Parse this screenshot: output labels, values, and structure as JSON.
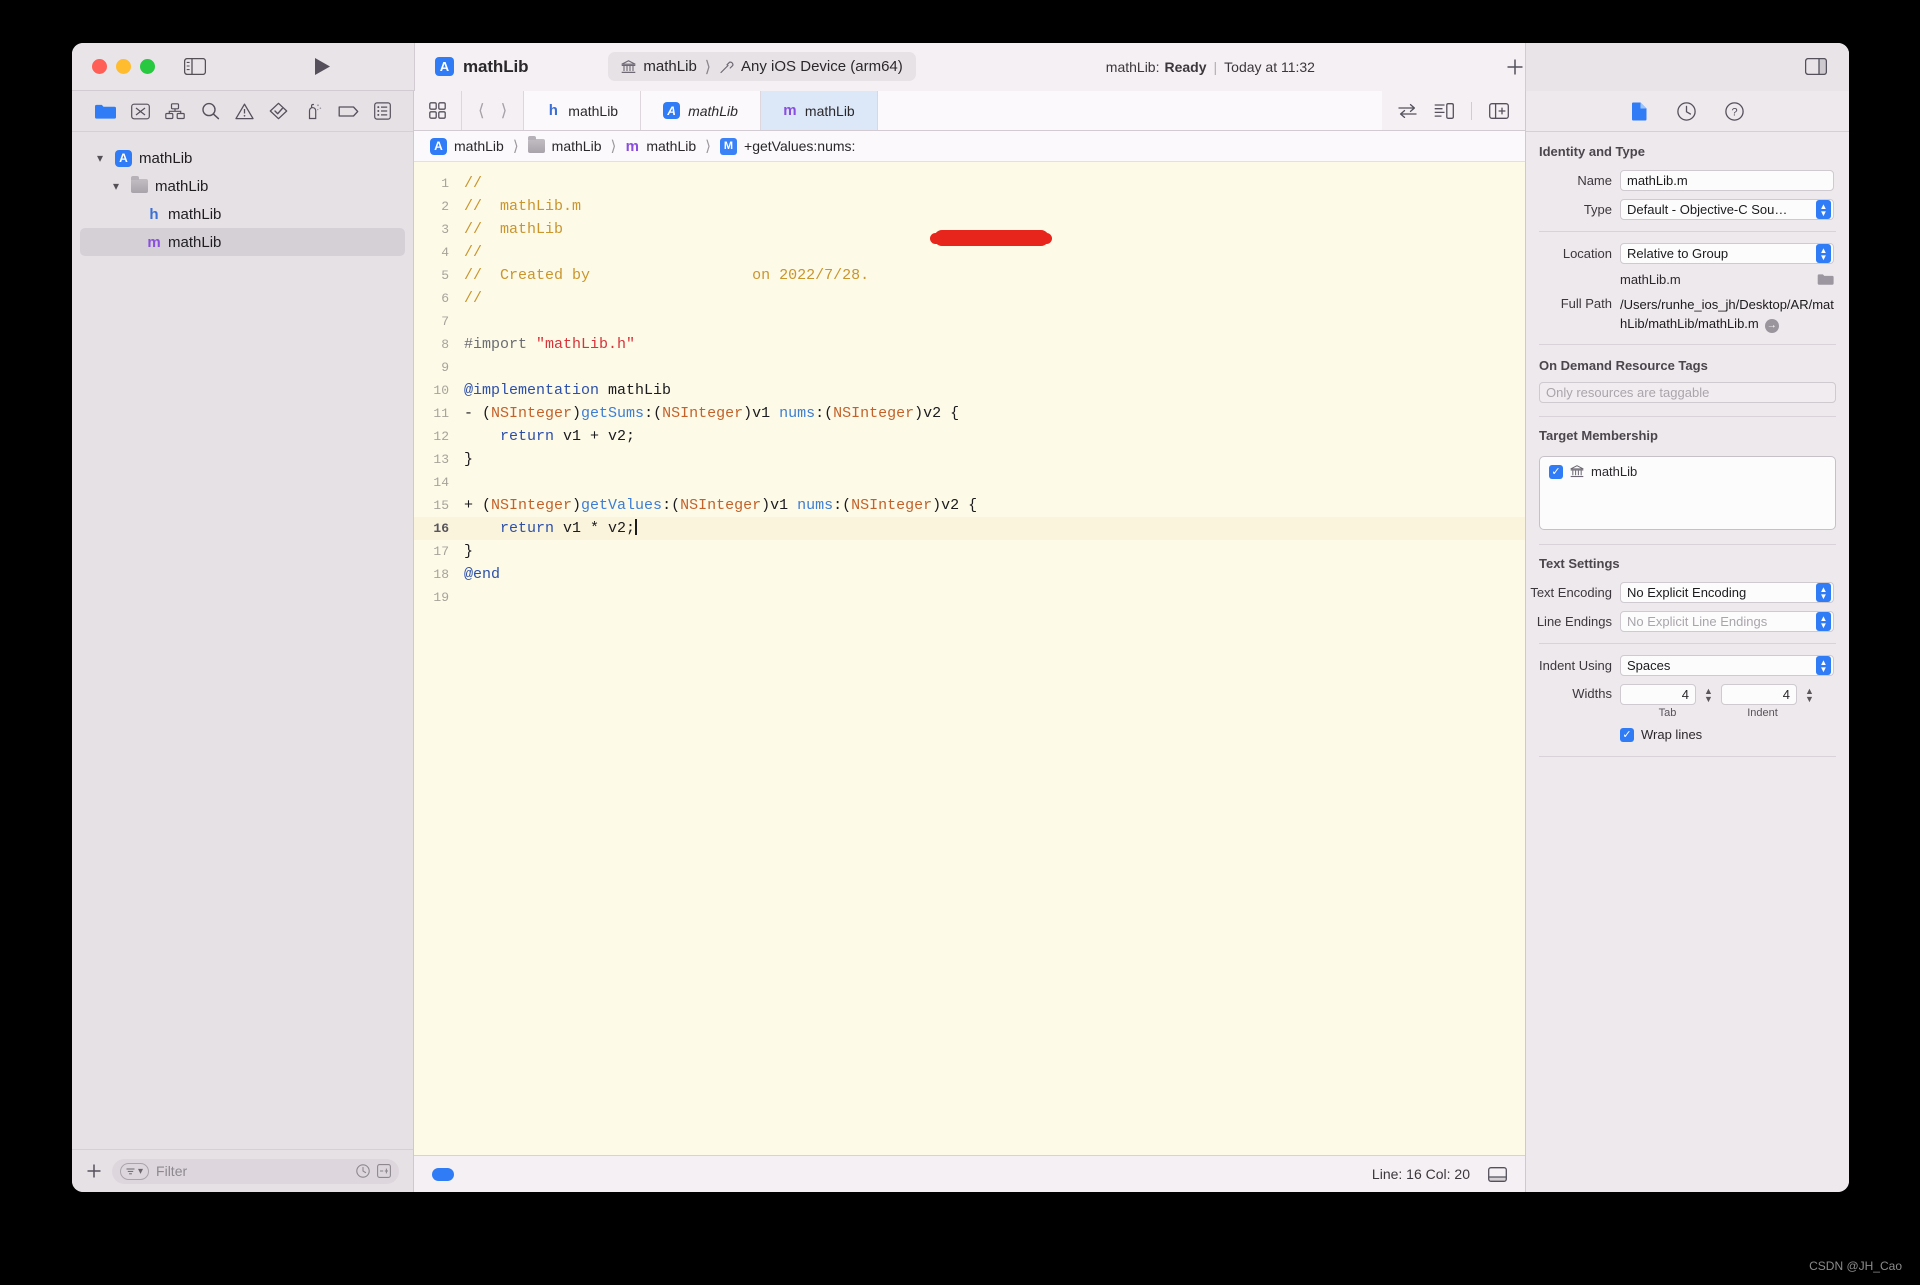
{
  "titlebar": {
    "scheme_name": "mathLib",
    "app_icon": "app-store-icon",
    "destination_project": "mathLib",
    "destination_device": "Any iOS Device (arm64)",
    "status_prefix": "mathLib:",
    "status_state": "Ready",
    "status_time": "Today at 11:32",
    "add_label": "+"
  },
  "navigator": {
    "icons": [
      "folder-icon",
      "source-control-icon",
      "hierarchy-icon",
      "search-icon",
      "warning-icon",
      "test-icon",
      "debug-icon",
      "breakpoint-icon",
      "report-icon"
    ],
    "tree": [
      {
        "label": "mathLib",
        "kind": "project",
        "depth": 0,
        "expanded": true,
        "selected": false
      },
      {
        "label": "mathLib",
        "kind": "folder",
        "depth": 1,
        "expanded": true,
        "selected": false
      },
      {
        "label": "mathLib",
        "kind": "header",
        "depth": 2,
        "expanded": false,
        "selected": false
      },
      {
        "label": "mathLib",
        "kind": "impl",
        "depth": 2,
        "expanded": false,
        "selected": true
      }
    ],
    "footer": {
      "add_label": "+",
      "filter_placeholder": "Filter"
    }
  },
  "editor": {
    "tabs": [
      {
        "label": "mathLib",
        "kind": "header",
        "active": false,
        "italic": false
      },
      {
        "label": "mathLib",
        "kind": "project",
        "active": false,
        "italic": true
      },
      {
        "label": "mathLib",
        "kind": "impl",
        "active": true,
        "italic": false
      }
    ],
    "breadcrumb": [
      {
        "label": "mathLib",
        "kind": "project"
      },
      {
        "label": "mathLib",
        "kind": "folder"
      },
      {
        "label": "mathLib",
        "kind": "impl"
      },
      {
        "label": "+getValues:nums:",
        "kind": "method"
      }
    ],
    "lines": [
      {
        "n": 1,
        "tokens": [
          {
            "t": "//",
            "c": "cm"
          }
        ]
      },
      {
        "n": 2,
        "tokens": [
          {
            "t": "//  mathLib.m",
            "c": "cm"
          }
        ]
      },
      {
        "n": 3,
        "tokens": [
          {
            "t": "//  mathLib",
            "c": "cm"
          }
        ]
      },
      {
        "n": 4,
        "tokens": [
          {
            "t": "//",
            "c": "cm"
          }
        ]
      },
      {
        "n": 5,
        "tokens": [
          {
            "t": "//  Created by ",
            "c": "cm"
          },
          {
            "t": "                 ",
            "c": "cm"
          },
          {
            "t": "on 2022/7/28.",
            "c": "cm"
          }
        ]
      },
      {
        "n": 6,
        "tokens": [
          {
            "t": "//",
            "c": "cm"
          }
        ]
      },
      {
        "n": 7,
        "tokens": []
      },
      {
        "n": 8,
        "tokens": [
          {
            "t": "#import ",
            "c": "pp"
          },
          {
            "t": "\"mathLib.h\"",
            "c": "str"
          }
        ]
      },
      {
        "n": 9,
        "tokens": []
      },
      {
        "n": 10,
        "tokens": [
          {
            "t": "@implementation",
            "c": "kw"
          },
          {
            "t": " mathLib",
            "c": ""
          }
        ]
      },
      {
        "n": 11,
        "tokens": [
          {
            "t": "- (",
            "c": ""
          },
          {
            "t": "NSInteger",
            "c": "ty"
          },
          {
            "t": ")",
            "c": ""
          },
          {
            "t": "getSums",
            "c": "mth"
          },
          {
            "t": ":(",
            "c": ""
          },
          {
            "t": "NSInteger",
            "c": "ty"
          },
          {
            "t": ")v1 ",
            "c": ""
          },
          {
            "t": "nums",
            "c": "mth"
          },
          {
            "t": ":(",
            "c": ""
          },
          {
            "t": "NSInteger",
            "c": "ty"
          },
          {
            "t": ")v2 {",
            "c": ""
          }
        ]
      },
      {
        "n": 12,
        "tokens": [
          {
            "t": "    ",
            "c": ""
          },
          {
            "t": "return",
            "c": "kw"
          },
          {
            "t": " v1 + v2;",
            "c": ""
          }
        ]
      },
      {
        "n": 13,
        "tokens": [
          {
            "t": "}",
            "c": ""
          }
        ]
      },
      {
        "n": 14,
        "tokens": []
      },
      {
        "n": 15,
        "tokens": [
          {
            "t": "+ (",
            "c": ""
          },
          {
            "t": "NSInteger",
            "c": "ty"
          },
          {
            "t": ")",
            "c": ""
          },
          {
            "t": "getValues",
            "c": "mth"
          },
          {
            "t": ":(",
            "c": ""
          },
          {
            "t": "NSInteger",
            "c": "ty"
          },
          {
            "t": ")v1 ",
            "c": ""
          },
          {
            "t": "nums",
            "c": "mth"
          },
          {
            "t": ":(",
            "c": ""
          },
          {
            "t": "NSInteger",
            "c": "ty"
          },
          {
            "t": ")v2 {",
            "c": ""
          }
        ]
      },
      {
        "n": 16,
        "tokens": [
          {
            "t": "    ",
            "c": ""
          },
          {
            "t": "return",
            "c": "kw"
          },
          {
            "t": " v1 * v2;",
            "c": ""
          }
        ],
        "current": true,
        "caret": true
      },
      {
        "n": 17,
        "tokens": [
          {
            "t": "}",
            "c": ""
          }
        ]
      },
      {
        "n": 18,
        "tokens": [
          {
            "t": "@end",
            "c": "kw"
          }
        ]
      },
      {
        "n": 19,
        "tokens": []
      }
    ],
    "statusbar": {
      "line_col": "Line: 16  Col: 20"
    }
  },
  "inspector": {
    "tabs": [
      "file-inspector-icon",
      "history-inspector-icon",
      "quick-help-icon"
    ],
    "identity": {
      "title": "Identity and Type",
      "name_label": "Name",
      "name_value": "mathLib.m",
      "type_label": "Type",
      "type_value": "Default - Objective-C Sou…",
      "location_label": "Location",
      "location_value": "Relative to Group",
      "location_file": "mathLib.m",
      "fullpath_label": "Full Path",
      "fullpath_value": "/Users/runhe_ios_jh/Desktop/AR/mathLib/mathLib/mathLib.m"
    },
    "ondemand": {
      "title": "On Demand Resource Tags",
      "placeholder": "Only resources are taggable"
    },
    "target": {
      "title": "Target Membership",
      "items": [
        {
          "label": "mathLib",
          "checked": true
        }
      ]
    },
    "text_settings": {
      "title": "Text Settings",
      "encoding_label": "Text Encoding",
      "encoding_value": "No Explicit Encoding",
      "line_endings_label": "Line Endings",
      "line_endings_value": "No Explicit Line Endings",
      "indent_label": "Indent Using",
      "indent_value": "Spaces",
      "widths_label": "Widths",
      "tab_width": "4",
      "indent_width": "4",
      "tab_sublabel": "Tab",
      "indent_sublabel": "Indent",
      "wrap_label": "Wrap lines",
      "wrap_checked": true
    }
  },
  "watermark": "CSDN @JH_Cao",
  "colors": {
    "accent": "#2f7cf6",
    "editor_bg": "#fdfae8",
    "comment": "#c9952c",
    "string": "#d6333a",
    "keyword": "#2c4fa8",
    "type": "#c2622a",
    "method": "#3d7dd4",
    "redaction": "#e8251c"
  }
}
